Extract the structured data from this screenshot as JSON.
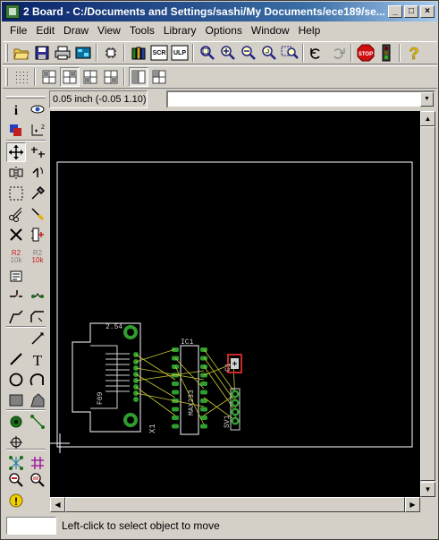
{
  "window": {
    "title": "2 Board - C:/Documents and Settings/sashi/My Documents/ece189/se...",
    "minimize_glyph": "_",
    "maximize_glyph": "□",
    "close_glyph": "×"
  },
  "menu": {
    "items": [
      "File",
      "Edit",
      "Draw",
      "View",
      "Tools",
      "Library",
      "Options",
      "Window",
      "Help"
    ]
  },
  "toolbar": {
    "open_icon": "folder-open-icon",
    "save_icon": "save-icon",
    "print_icon": "print-icon",
    "cam_icon": "cam-processor-icon",
    "switch_icon": "switch-to-schematic-icon",
    "library_icon": "use-library-icon",
    "script_label": "SCR",
    "ulp_label": "ULP",
    "zoom_icons": [
      "zoom-fit-icon",
      "zoom-in-icon",
      "zoom-out-icon",
      "zoom-redraw-icon",
      "zoom-select-icon"
    ],
    "undo_icon": "undo-icon",
    "redo_icon": "redo-icon",
    "stop_label": "STOP",
    "go_icon": "go-icon",
    "help_icon": "help-icon"
  },
  "layerbar": {
    "icons": [
      "grid-icon",
      "layer-top-icon",
      "layer-top-pressed-icon",
      "layer-bottom-icon",
      "layer-both-icon",
      "layer-view-icon",
      "layer-split-icon"
    ]
  },
  "parambar": {
    "coordinate": "0.05 inch (-0.05 1.10)",
    "command_value": "",
    "command_placeholder": ""
  },
  "palette": {
    "tools": [
      "info-icon",
      "show-icon",
      "display-icon",
      "mark-icon",
      "move-icon",
      "copy-icon",
      "mirror-icon",
      "rotate-icon",
      "group-icon",
      "change-icon",
      "cut-icon",
      "paste-icon",
      "delete-icon",
      "add-icon",
      "name-icon",
      "value-icon",
      "smash-icon",
      "miter-icon",
      "split-icon",
      "optimize-icon",
      "route-icon",
      "ripup-icon",
      "wire-icon",
      "text-icon",
      "circle-icon",
      "arc-icon",
      "rect-icon",
      "polygon-icon",
      "via-icon",
      "signal-icon",
      "hole-icon",
      "ratsnest-icon",
      "auto-icon",
      "drc-icon",
      "errors-icon",
      "warning-icon"
    ],
    "name_label": "R2",
    "value_label": "10k",
    "text_glyph": "T"
  },
  "board": {
    "connector_label": "2.54",
    "connector_name": "F09",
    "connector_ref": "X1",
    "ic_name": "IC1",
    "ic_value": "MAX233",
    "cap_name": "C1",
    "header_name": "SV1",
    "colors": {
      "background": "#000000",
      "outline": "#ffffff",
      "pad": "#2e9e2e",
      "airwire": "#c8c832",
      "part": "#d0d0d0",
      "cap_red": "#c82828"
    }
  },
  "status": {
    "field_value": "",
    "message": "Left-click to select object to move"
  }
}
